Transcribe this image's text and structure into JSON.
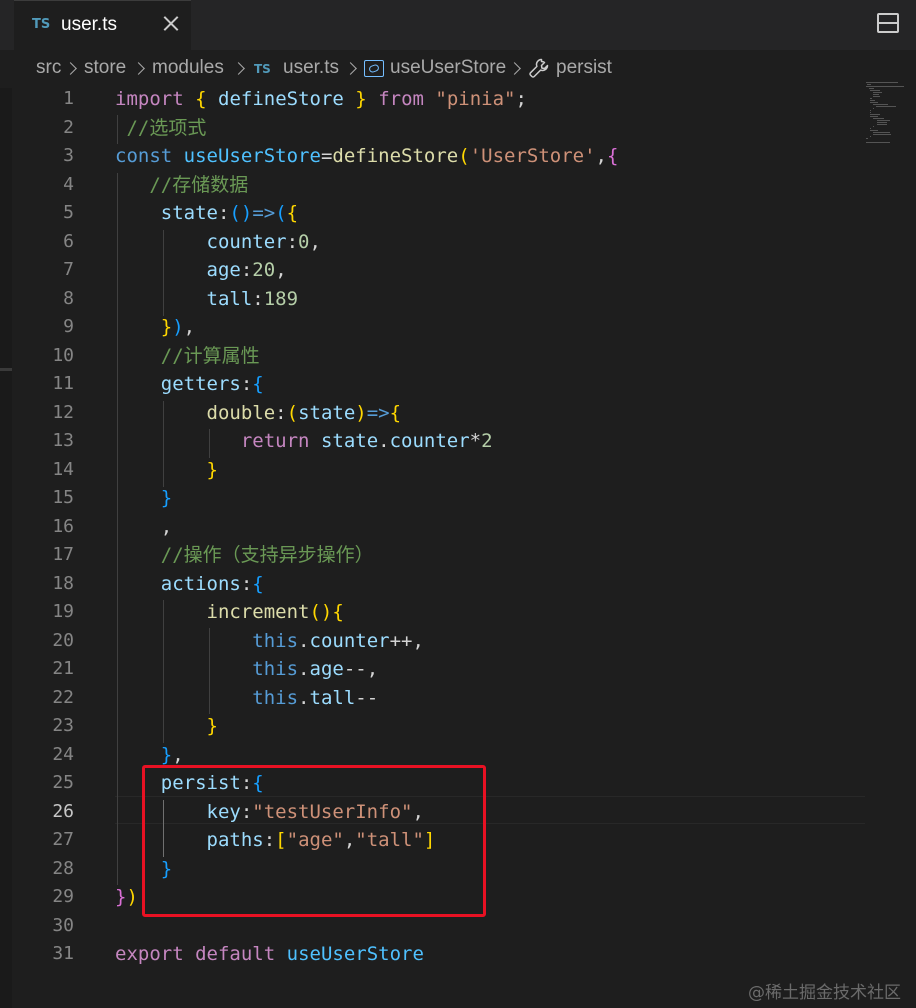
{
  "tab": {
    "icon": "typescript-icon",
    "lang_badge": "TS",
    "filename": "user.ts"
  },
  "breadcrumb": {
    "items": [
      "src",
      "store",
      "modules",
      "user.ts",
      "useUserStore",
      "persist"
    ],
    "file_badge": "TS"
  },
  "editor": {
    "active_line": 26,
    "line_numbers": [
      "1",
      "2",
      "3",
      "4",
      "5",
      "6",
      "7",
      "8",
      "9",
      "10",
      "11",
      "12",
      "13",
      "14",
      "15",
      "16",
      "17",
      "18",
      "19",
      "20",
      "21",
      "22",
      "23",
      "24",
      "25",
      "26",
      "27",
      "28",
      "29",
      "30",
      "31"
    ],
    "lines": [
      [
        [
          "kw-ctrl",
          "import"
        ],
        [
          "pl",
          " "
        ],
        [
          "b1",
          "{"
        ],
        [
          "pl",
          " "
        ],
        [
          "var",
          "defineStore"
        ],
        [
          "pl",
          " "
        ],
        [
          "b1",
          "}"
        ],
        [
          "pl",
          " "
        ],
        [
          "kw-ctrl",
          "from"
        ],
        [
          "pl",
          " "
        ],
        [
          "str",
          "\"pinia\""
        ],
        [
          "pl",
          ";"
        ]
      ],
      [
        [
          "pl",
          " "
        ],
        [
          "cm",
          "//选项式"
        ]
      ],
      [
        [
          "kw",
          "const"
        ],
        [
          "pl",
          " "
        ],
        [
          "const",
          "useUserStore"
        ],
        [
          "pl",
          "="
        ],
        [
          "fn",
          "defineStore"
        ],
        [
          "b1",
          "("
        ],
        [
          "str",
          "'UserStore'"
        ],
        [
          "pl",
          ","
        ],
        [
          "b2",
          "{"
        ]
      ],
      [
        [
          "pl",
          "   "
        ],
        [
          "cm",
          "//存储数据"
        ]
      ],
      [
        [
          "pl",
          "    "
        ],
        [
          "var",
          "state"
        ],
        [
          "pl",
          ":"
        ],
        [
          "b3",
          "()"
        ],
        [
          "kw",
          "=>"
        ],
        [
          "b3",
          "("
        ],
        [
          "b1",
          "{"
        ]
      ],
      [
        [
          "pl",
          "        "
        ],
        [
          "var",
          "counter"
        ],
        [
          "pl",
          ":"
        ],
        [
          "num",
          "0"
        ],
        [
          "pl",
          ","
        ]
      ],
      [
        [
          "pl",
          "        "
        ],
        [
          "var",
          "age"
        ],
        [
          "pl",
          ":"
        ],
        [
          "num",
          "20"
        ],
        [
          "pl",
          ","
        ]
      ],
      [
        [
          "pl",
          "        "
        ],
        [
          "var",
          "tall"
        ],
        [
          "pl",
          ":"
        ],
        [
          "num",
          "189"
        ]
      ],
      [
        [
          "pl",
          "    "
        ],
        [
          "b1",
          "}"
        ],
        [
          "b3",
          ")"
        ],
        [
          "pl",
          ","
        ]
      ],
      [
        [
          "pl",
          "    "
        ],
        [
          "cm",
          "//计算属性"
        ]
      ],
      [
        [
          "pl",
          "    "
        ],
        [
          "var",
          "getters"
        ],
        [
          "pl",
          ":"
        ],
        [
          "b3",
          "{"
        ]
      ],
      [
        [
          "pl",
          "        "
        ],
        [
          "fn",
          "double"
        ],
        [
          "pl",
          ":"
        ],
        [
          "b1",
          "("
        ],
        [
          "var",
          "state"
        ],
        [
          "b1",
          ")"
        ],
        [
          "kw",
          "=>"
        ],
        [
          "b1",
          "{"
        ]
      ],
      [
        [
          "pl",
          "           "
        ],
        [
          "kw-ctrl",
          "return"
        ],
        [
          "pl",
          " "
        ],
        [
          "var",
          "state"
        ],
        [
          "pl",
          "."
        ],
        [
          "var",
          "counter"
        ],
        [
          "pl",
          "*"
        ],
        [
          "num",
          "2"
        ]
      ],
      [
        [
          "pl",
          "        "
        ],
        [
          "b1",
          "}"
        ]
      ],
      [
        [
          "pl",
          "    "
        ],
        [
          "b3",
          "}"
        ]
      ],
      [
        [
          "pl",
          "    ,"
        ]
      ],
      [
        [
          "pl",
          "    "
        ],
        [
          "cm",
          "//操作（支持异步操作）"
        ]
      ],
      [
        [
          "pl",
          "    "
        ],
        [
          "var",
          "actions"
        ],
        [
          "pl",
          ":"
        ],
        [
          "b3",
          "{"
        ]
      ],
      [
        [
          "pl",
          "        "
        ],
        [
          "fn",
          "increment"
        ],
        [
          "b1",
          "()"
        ],
        [
          "b1",
          "{"
        ]
      ],
      [
        [
          "pl",
          "            "
        ],
        [
          "kw",
          "this"
        ],
        [
          "pl",
          "."
        ],
        [
          "var",
          "counter"
        ],
        [
          "pl",
          "++,"
        ]
      ],
      [
        [
          "pl",
          "            "
        ],
        [
          "kw",
          "this"
        ],
        [
          "pl",
          "."
        ],
        [
          "var",
          "age"
        ],
        [
          "pl",
          "--,"
        ]
      ],
      [
        [
          "pl",
          "            "
        ],
        [
          "kw",
          "this"
        ],
        [
          "pl",
          "."
        ],
        [
          "var",
          "tall"
        ],
        [
          "pl",
          "--"
        ]
      ],
      [
        [
          "pl",
          "        "
        ],
        [
          "b1",
          "}"
        ]
      ],
      [
        [
          "pl",
          "    "
        ],
        [
          "b3",
          "}"
        ],
        [
          "pl",
          ","
        ]
      ],
      [
        [
          "pl",
          "    "
        ],
        [
          "var",
          "persist"
        ],
        [
          "pl",
          ":"
        ],
        [
          "b3",
          "{"
        ]
      ],
      [
        [
          "pl",
          "        "
        ],
        [
          "var",
          "key"
        ],
        [
          "pl",
          ":"
        ],
        [
          "str",
          "\"testUserInfo\""
        ],
        [
          "pl",
          ","
        ]
      ],
      [
        [
          "pl",
          "        "
        ],
        [
          "var",
          "paths"
        ],
        [
          "pl",
          ":"
        ],
        [
          "b1",
          "["
        ],
        [
          "str",
          "\"age\""
        ],
        [
          "pl",
          ","
        ],
        [
          "str",
          "\"tall\""
        ],
        [
          "b1",
          "]"
        ]
      ],
      [
        [
          "pl",
          "    "
        ],
        [
          "b3",
          "}"
        ]
      ],
      [
        [
          "b2",
          "}"
        ],
        [
          "b1",
          ")"
        ]
      ],
      [],
      [
        [
          "kw-ctrl",
          "export"
        ],
        [
          "pl",
          " "
        ],
        [
          "kw-ctrl",
          "default"
        ],
        [
          "pl",
          " "
        ],
        [
          "const",
          "useUserStore"
        ]
      ]
    ]
  },
  "watermark": "@稀土掘金技术社区",
  "colors": {
    "highlight_box": "#e81123",
    "background": "#1e1e1e"
  }
}
